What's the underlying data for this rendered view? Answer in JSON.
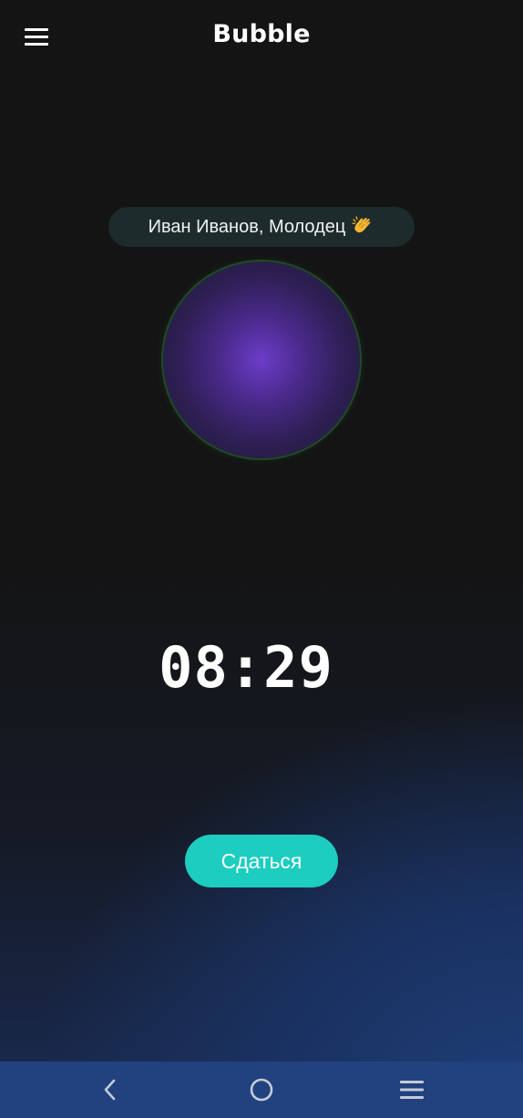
{
  "header": {
    "title": "Bubble",
    "menu_icon": "hamburger-menu-icon"
  },
  "greeting": {
    "text": "Иван Иванов, Молодец",
    "emoji_icon": "clapping-hands-icon"
  },
  "bubble": {
    "icon": "breathing-bubble"
  },
  "timer": {
    "value": "08:29"
  },
  "actions": {
    "surrender_label": "Сдаться"
  },
  "system_nav": {
    "back_icon": "back-chevron-icon",
    "home_icon": "home-circle-icon",
    "recents_icon": "recents-menu-icon"
  },
  "colors": {
    "accent": "#1ccdc0",
    "bubble_core": "#6c3cc9",
    "bubble_ring": "#1f4a25",
    "nav_bar": "#22417f",
    "background": "#141414"
  }
}
